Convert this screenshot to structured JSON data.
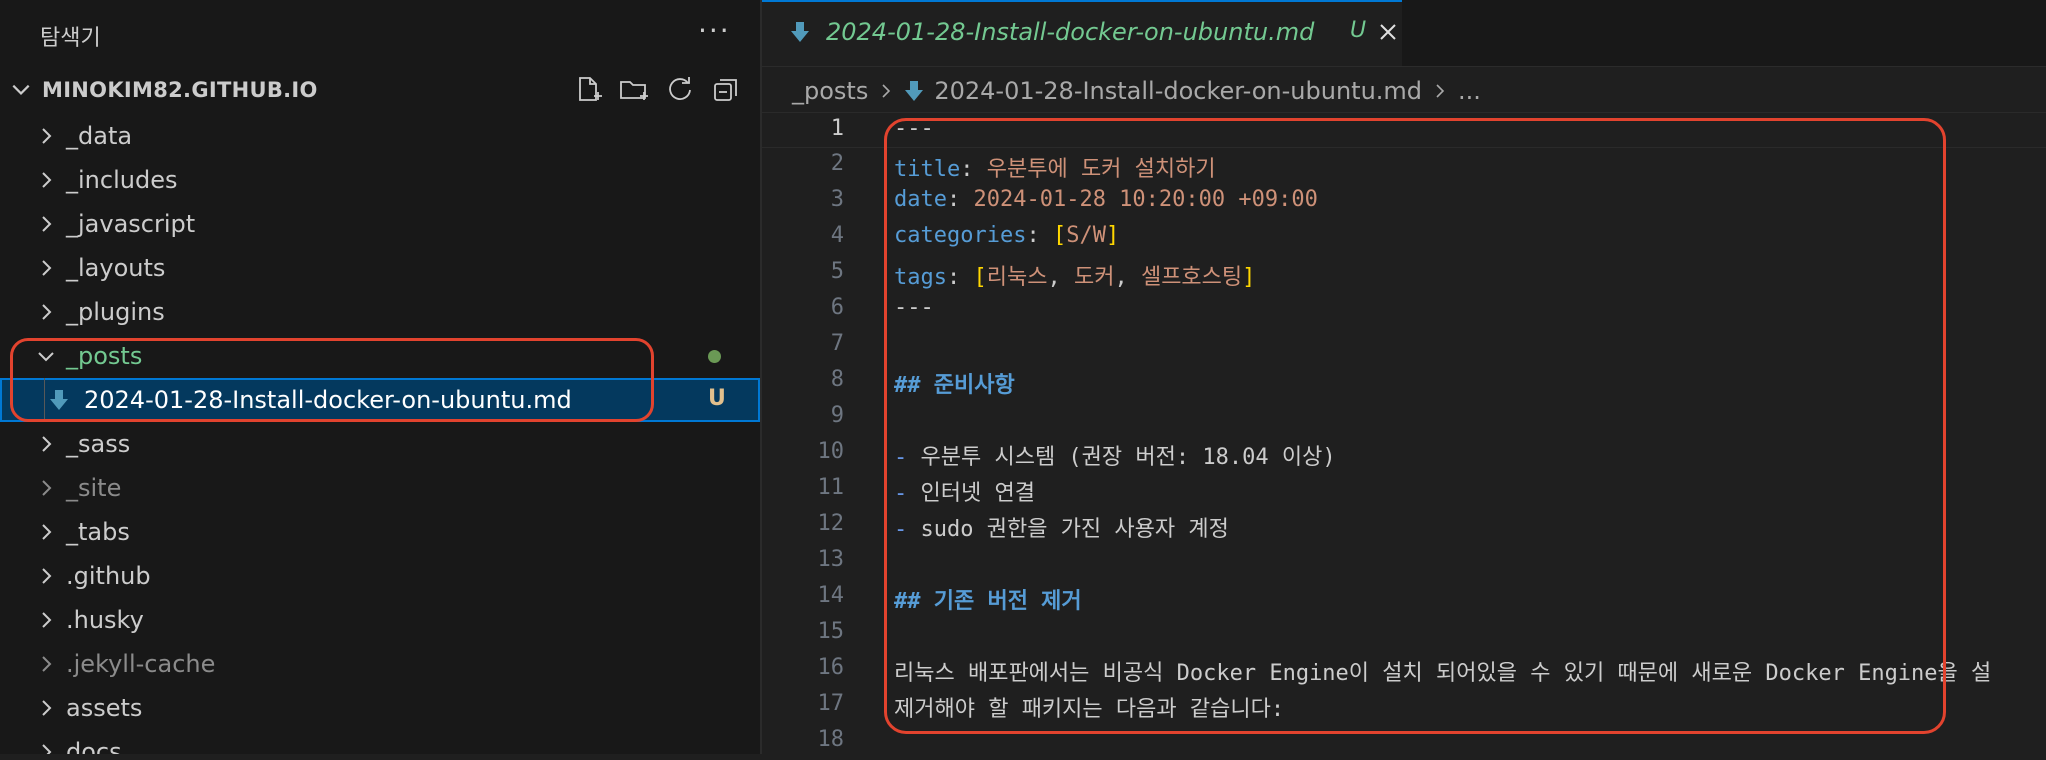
{
  "sidebar": {
    "title": "탐색기",
    "more": "···",
    "project": "MINOKIM82.GITHUB.IO",
    "items": [
      {
        "label": "_data"
      },
      {
        "label": "_includes"
      },
      {
        "label": "_javascript"
      },
      {
        "label": "_layouts"
      },
      {
        "label": "_plugins"
      },
      {
        "label": "_posts"
      },
      {
        "label": "2024-01-28-Install-docker-on-ubuntu.md",
        "badge": "U"
      },
      {
        "label": "_sass"
      },
      {
        "label": "_site"
      },
      {
        "label": "_tabs"
      },
      {
        "label": ".github"
      },
      {
        "label": ".husky"
      },
      {
        "label": ".jekyll-cache"
      },
      {
        "label": "assets"
      },
      {
        "label": "docs"
      }
    ]
  },
  "tab": {
    "label": "2024-01-28-Install-docker-on-ubuntu.md",
    "status": "U"
  },
  "breadcrumb": {
    "folder": "_posts",
    "file": "2024-01-28-Install-docker-on-ubuntu.md",
    "ellipsis": "..."
  },
  "code": {
    "l1": "---",
    "l2k": "title",
    "l2c": ": ",
    "l2v": "우분투에 도커 설치하기",
    "l3k": "date",
    "l3c": ": ",
    "l3v": "2024-01-28 10:20:00 +09:00",
    "l4k": "categories",
    "l4c": ": ",
    "l4o": "[",
    "l4v": "S/W",
    "l4e": "]",
    "l5k": "tags",
    "l5c": ": ",
    "l5o": "[",
    "l5v1": "리눅스",
    "l5s1": ", ",
    "l5v2": "도커",
    "l5s2": ", ",
    "l5v3": "셀프호스팅",
    "l5e": "]",
    "l6": "---",
    "l8": "## 준비사항",
    "l10d": "- ",
    "l10": "우분투 시스템 (권장 버전: 18.04 이상)",
    "l11d": "- ",
    "l11": "인터넷 연결",
    "l12d": "- ",
    "l12": "sudo 권한을 가진 사용자 계정",
    "l14": "## 기존 버전 제거",
    "l16": "리눅스 배포판에서는 비공식 Docker Engine이 설치 되어있을 수 있기 때문에 새로운 Docker Engine을 설",
    "l17": "제거해야 할 패키지는 다음과 같습니다:"
  },
  "line_numbers": [
    "1",
    "2",
    "3",
    "4",
    "5",
    "6",
    "7",
    "8",
    "9",
    "10",
    "11",
    "12",
    "13",
    "14",
    "15",
    "16",
    "17",
    "18"
  ]
}
